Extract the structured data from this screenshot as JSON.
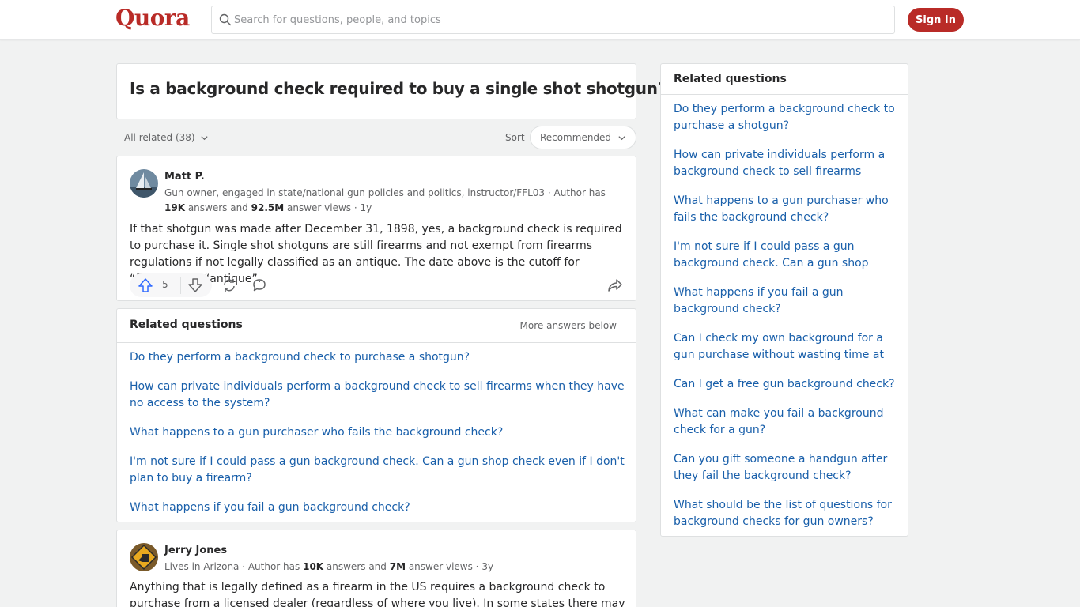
{
  "header": {
    "logo": "Quora",
    "search_placeholder": "Search for questions, people, and topics",
    "signin_label": "Sign In"
  },
  "question": {
    "title": "Is a background check required to buy a single shot shotgun?"
  },
  "filters": {
    "all_related": "All related (38)",
    "sort_label": "Sort",
    "sort_value": "Recommended"
  },
  "answers": [
    {
      "author": "Matt P.",
      "cred_a": "Gun owner, engaged in state/national gun policies and politics, instructor/FFL03 · Author has ",
      "cred_answers": "19K",
      "cred_b": " answers and ",
      "cred_views": "92.5M",
      "cred_c": " answer views · 1y",
      "text": "If that shotgun was made after December 31, 1898, yes, a background check is required to purchase it. Single shot shotguns are still firearms and not exempt from firearms regulations if not legally classified as an antique. The date above is the cutoff for “firearm” vs. “antique”.",
      "upvotes": "5"
    },
    {
      "author": "Jerry Jones",
      "cred_a": "Lives in Arizona · Author has ",
      "cred_answers": "10K",
      "cred_b": " answers and ",
      "cred_views": "7M",
      "cred_c": " answer views · 3y",
      "text": "Anything that is legally defined as a firearm in the US requires a background check to purchase from a licensed dealer (regardless of where you live). In some states there may be"
    }
  ],
  "inline_related": {
    "title": "Related questions",
    "more": "More answers below",
    "items": [
      "Do they perform a background check to purchase a shotgun?",
      "How can private individuals perform a background check to sell firearms when they have no access to the system?",
      "What happens to a gun purchaser who fails the background check?",
      "I'm not sure if I could pass a gun background check. Can a gun shop check even if I don't plan to buy a firearm?",
      "What happens if you fail a gun background check?"
    ]
  },
  "sidebar": {
    "title": "Related questions",
    "items": [
      "Do they perform a background check to purchase a shotgun?",
      "How can private individuals perform a background check to sell firearms when…",
      "What happens to a gun purchaser who fails the background check?",
      "I'm not sure if I could pass a gun background check. Can a gun shop chec…",
      "What happens if you fail a gun background check?",
      "Can I check my own background for a gun purchase without wasting time at the…",
      "Can I get a free gun background check?",
      "What can make you fail a background check for a gun?",
      "Can you gift someone a handgun after they fail the background check?",
      "What should be the list of questions for background checks for gun owners?"
    ]
  },
  "colors": {
    "brand": "#b92b27",
    "link": "#195faa",
    "upvote": "#2e69ff"
  }
}
